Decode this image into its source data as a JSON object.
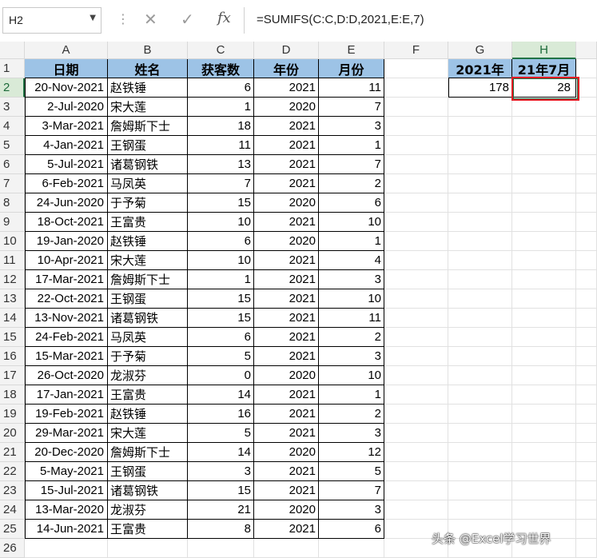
{
  "formula_bar": {
    "name_box": "H2",
    "fx_label": "fx",
    "formula": "=SUMIFS(C:C,D:D,2021,E:E,7)"
  },
  "columns": [
    "A",
    "B",
    "C",
    "D",
    "E",
    "F",
    "G",
    "H"
  ],
  "rows": [
    "1",
    "2",
    "3",
    "4",
    "5",
    "6",
    "7",
    "8",
    "9",
    "10",
    "11",
    "12",
    "13",
    "14",
    "15",
    "16",
    "17",
    "18",
    "19",
    "20",
    "21",
    "22",
    "23",
    "24",
    "25",
    "26"
  ],
  "table": {
    "headers": [
      "日期",
      "姓名",
      "获客数",
      "年份",
      "月份"
    ],
    "records": [
      [
        "20-Nov-2021",
        "赵铁锤",
        "6",
        "2021",
        "11"
      ],
      [
        "2-Jul-2020",
        "宋大莲",
        "1",
        "2020",
        "7"
      ],
      [
        "3-Mar-2021",
        "詹姆斯下士",
        "18",
        "2021",
        "3"
      ],
      [
        "4-Jan-2021",
        "王钢蛋",
        "11",
        "2021",
        "1"
      ],
      [
        "5-Jul-2021",
        "诸葛钢铁",
        "13",
        "2021",
        "7"
      ],
      [
        "6-Feb-2021",
        "马凤英",
        "7",
        "2021",
        "2"
      ],
      [
        "24-Jun-2020",
        "于予菊",
        "15",
        "2020",
        "6"
      ],
      [
        "18-Oct-2021",
        "王富贵",
        "10",
        "2021",
        "10"
      ],
      [
        "19-Jan-2020",
        "赵铁锤",
        "6",
        "2020",
        "1"
      ],
      [
        "10-Apr-2021",
        "宋大莲",
        "10",
        "2021",
        "4"
      ],
      [
        "17-Mar-2021",
        "詹姆斯下士",
        "1",
        "2021",
        "3"
      ],
      [
        "22-Oct-2021",
        "王钢蛋",
        "15",
        "2021",
        "10"
      ],
      [
        "13-Nov-2021",
        "诸葛钢铁",
        "15",
        "2021",
        "11"
      ],
      [
        "24-Feb-2021",
        "马凤英",
        "6",
        "2021",
        "2"
      ],
      [
        "15-Mar-2021",
        "于予菊",
        "5",
        "2021",
        "3"
      ],
      [
        "26-Oct-2020",
        "龙淑芬",
        "0",
        "2020",
        "10"
      ],
      [
        "17-Jan-2021",
        "王富贵",
        "14",
        "2021",
        "1"
      ],
      [
        "19-Feb-2021",
        "赵铁锤",
        "16",
        "2021",
        "2"
      ],
      [
        "29-Mar-2021",
        "宋大莲",
        "5",
        "2021",
        "3"
      ],
      [
        "20-Dec-2020",
        "詹姆斯下士",
        "14",
        "2020",
        "12"
      ],
      [
        "5-May-2021",
        "王钢蛋",
        "3",
        "2021",
        "5"
      ],
      [
        "15-Jul-2021",
        "诸葛钢铁",
        "15",
        "2021",
        "7"
      ],
      [
        "13-Mar-2020",
        "龙淑芬",
        "21",
        "2020",
        "3"
      ],
      [
        "14-Jun-2021",
        "王富贵",
        "8",
        "2021",
        "6"
      ]
    ]
  },
  "summary": {
    "headers": [
      "2021年",
      "21年7月"
    ],
    "values": [
      "178",
      "28"
    ]
  },
  "watermark": "头条 @Excel学习世界",
  "colors": {
    "header_fill": "#9dc3e6",
    "selection_highlight": "#e31b23",
    "active_header": "#d9ead7"
  }
}
